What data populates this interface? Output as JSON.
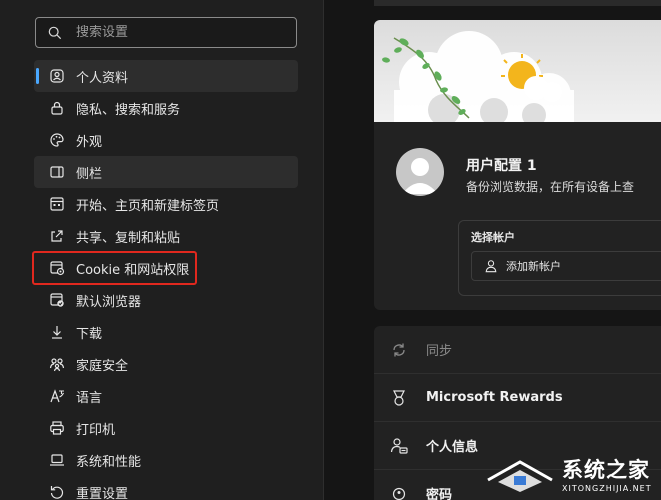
{
  "search": {
    "placeholder": "搜索设置",
    "value": ""
  },
  "sidebar": {
    "items": [
      {
        "label": "个人资料",
        "icon": "profile-icon"
      },
      {
        "label": "隐私、搜索和服务",
        "icon": "lock-icon"
      },
      {
        "label": "外观",
        "icon": "palette-icon"
      },
      {
        "label": "侧栏",
        "icon": "sidebar-icon"
      },
      {
        "label": "开始、主页和新建标签页",
        "icon": "home-grid-icon"
      },
      {
        "label": "共享、复制和粘贴",
        "icon": "share-icon"
      },
      {
        "label": "Cookie 和网站权限",
        "icon": "cookie-settings-icon"
      },
      {
        "label": "默认浏览器",
        "icon": "default-browser-icon"
      },
      {
        "label": "下载",
        "icon": "download-icon"
      },
      {
        "label": "家庭安全",
        "icon": "family-icon"
      },
      {
        "label": "语言",
        "icon": "language-icon"
      },
      {
        "label": "打印机",
        "icon": "printer-icon"
      },
      {
        "label": "系统和性能",
        "icon": "laptop-icon"
      },
      {
        "label": "重置设置",
        "icon": "reset-icon"
      }
    ],
    "active_index": 0,
    "highlighted_index": 3,
    "boxed_index": 6
  },
  "profile": {
    "name": "用户配置 1",
    "description": "备份浏览数据，在所有设备上查"
  },
  "account": {
    "title": "选择帐户",
    "add_label": "添加新帐户"
  },
  "settings_rows": [
    {
      "label": "同步",
      "icon": "sync-icon",
      "dim": true
    },
    {
      "label": "Microsoft Rewards",
      "icon": "rewards-icon",
      "dim": false
    },
    {
      "label": "个人信息",
      "icon": "personal-info-icon",
      "dim": false
    },
    {
      "label": "密码",
      "icon": "key-icon",
      "dim": false
    }
  ],
  "watermark": {
    "text": "系统之家",
    "sub": "XITONGZHIJIA.NET"
  },
  "colors": {
    "accent": "#4aa8ff",
    "highlight_box": "#e0281e",
    "sidebar_bg": "#1f1f1f",
    "card_bg": "#222222"
  }
}
